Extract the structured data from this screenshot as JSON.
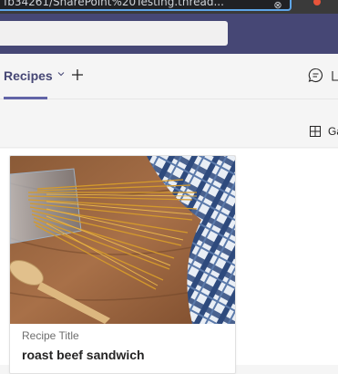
{
  "browser": {
    "url_text": "fb34261/SharePoint%20Testing.thread...",
    "clear_icon": "close-x-icon"
  },
  "teams_header": {
    "search_placeholder": ""
  },
  "tabs": [
    {
      "label": "Recipes",
      "active": true,
      "icon": "chevron-down-icon"
    }
  ],
  "tab_actions": {
    "add_icon": "plus-icon",
    "chat_icon": "chat-bubble-icon",
    "popout_icon": "popout-icon"
  },
  "toolbar": {
    "view_icon": "grid-icon",
    "view_label": "Ga"
  },
  "card": {
    "image_icon": "spaghetti-photo",
    "field_label": "Recipe Title",
    "title": "roast beef sandwich"
  },
  "colors": {
    "teams_purple": "#464775",
    "accent": "#6264a7",
    "url_focus": "#5ea6e8"
  }
}
